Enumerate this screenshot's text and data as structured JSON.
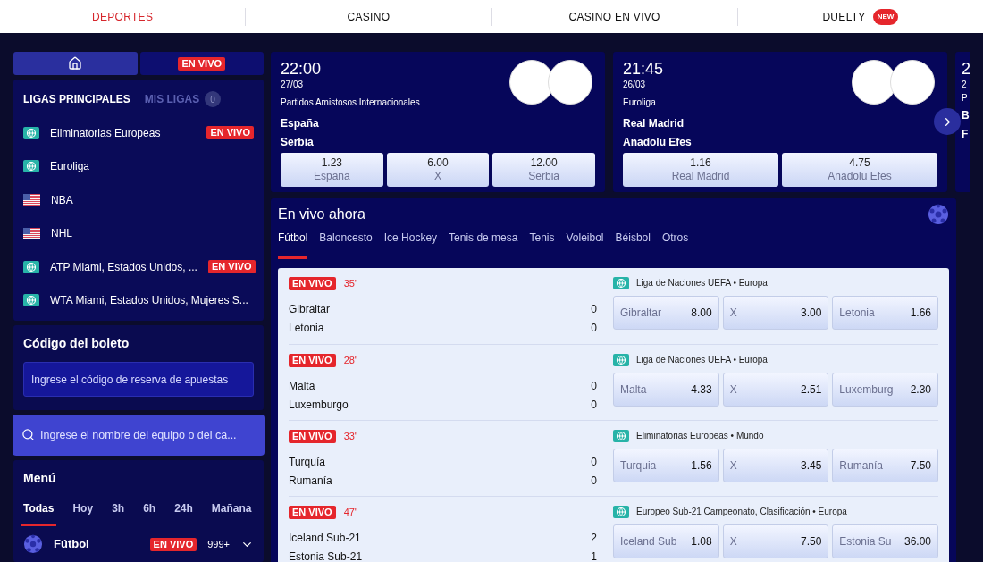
{
  "top_nav": [
    {
      "label": "DEPORTES",
      "selected": true
    },
    {
      "label": "CASINO",
      "selected": false
    },
    {
      "label": "CASINO EN VIVO",
      "selected": false
    },
    {
      "label": "DUELTY",
      "selected": false,
      "badge": "NEW"
    }
  ],
  "sidebar": {
    "view_tabs": [
      {
        "kind": "home",
        "selected": true
      },
      {
        "kind": "live",
        "label": "EN VIVO",
        "selected": false
      }
    ],
    "league_tabs": [
      {
        "label": "LIGAS PRINCIPALES",
        "selected": true
      },
      {
        "label": "MIS LIGAS",
        "selected": false,
        "count": "0"
      }
    ],
    "leagues": [
      {
        "name": "Eliminatorias Europeas",
        "kind": "globe",
        "badge": "EN VIVO"
      },
      {
        "name": "Euroliga",
        "kind": "globe"
      },
      {
        "name": "NBA",
        "kind": "us"
      },
      {
        "name": "NHL",
        "kind": "us"
      },
      {
        "name": "ATP Miami, Estados Unidos, ...",
        "kind": "globe",
        "badge": "EN VIVO"
      },
      {
        "name": "WTA Miami, Estados Unidos, Mujeres S...",
        "kind": "globe"
      }
    ],
    "ticket_code": {
      "title": "Código del boleto",
      "placeholder": "Ingrese el código de reserva de apuestas"
    },
    "search": {
      "placeholder": "Ingrese el nombre del equipo o del ca..."
    },
    "menu": {
      "title": "Menú",
      "filters": [
        {
          "label": "Todas",
          "selected": true
        },
        {
          "label": "Hoy",
          "selected": false
        },
        {
          "label": "3h",
          "selected": false
        },
        {
          "label": "6h",
          "selected": false
        },
        {
          "label": "24h",
          "selected": false
        },
        {
          "label": "Mañana",
          "selected": false
        }
      ],
      "sports": [
        {
          "name": "Fútbol",
          "badge": "EN VIVO",
          "count": "999+",
          "expanded": false
        }
      ]
    }
  },
  "featured": [
    {
      "time": "22:00",
      "date": "27/03",
      "league": "Partidos Amistosos Internacionales",
      "home": "España",
      "away": "Serbia",
      "odds": [
        {
          "value": "1.23",
          "label": "España"
        },
        {
          "value": "6.00",
          "label": "X"
        },
        {
          "value": "12.00",
          "label": "Serbia"
        }
      ]
    },
    {
      "time": "21:45",
      "date": "26/03",
      "league": "Euroliga",
      "home": "Real Madrid",
      "away": "Anadolu Efes",
      "odds": [
        {
          "value": "1.16",
          "label": "Real Madrid"
        },
        {
          "value": "4.75",
          "label": "Anadolu Efes"
        }
      ]
    }
  ],
  "featured_partial": {
    "time": "2",
    "date": "2",
    "league": "P",
    "home": "B",
    "away": "F"
  },
  "live_now": {
    "title": "En vivo ahora",
    "sport_tabs": [
      {
        "label": "Fútbol",
        "selected": true
      },
      {
        "label": "Baloncesto",
        "selected": false
      },
      {
        "label": "Ice Hockey",
        "selected": false
      },
      {
        "label": "Tenis de mesa",
        "selected": false
      },
      {
        "label": "Tenis",
        "selected": false
      },
      {
        "label": "Voleibol",
        "selected": false
      },
      {
        "label": "Béisbol",
        "selected": false
      },
      {
        "label": "Otros",
        "selected": false
      }
    ],
    "matches": [
      {
        "badge": "EN VIVO",
        "minute": "35'",
        "home": "Gibraltar",
        "away": "Letonia",
        "home_score": "0",
        "away_score": "0",
        "league": "Liga de Naciones UEFA • Europa",
        "odds": [
          {
            "label": "Gibraltar",
            "value": "8.00"
          },
          {
            "label": "X",
            "value": "3.00"
          },
          {
            "label": "Letonia",
            "value": "1.66"
          }
        ]
      },
      {
        "badge": "EN VIVO",
        "minute": "28'",
        "home": "Malta",
        "away": "Luxemburgo",
        "home_score": "0",
        "away_score": "0",
        "league": "Liga de Naciones UEFA • Europa",
        "odds": [
          {
            "label": "Malta",
            "value": "4.33"
          },
          {
            "label": "X",
            "value": "2.51"
          },
          {
            "label": "Luxemburg",
            "value": "2.30"
          }
        ]
      },
      {
        "badge": "EN VIVO",
        "minute": "33'",
        "home": "Turquía",
        "away": "Rumanía",
        "home_score": "0",
        "away_score": "0",
        "league": "Eliminatorias Europeas • Mundo",
        "odds": [
          {
            "label": "Turquia",
            "value": "1.56"
          },
          {
            "label": "X",
            "value": "3.45"
          },
          {
            "label": "Rumanía",
            "value": "7.50"
          }
        ]
      },
      {
        "badge": "EN VIVO",
        "minute": "47'",
        "home": "Iceland Sub-21",
        "away": "Estonia Sub-21",
        "home_score": "2",
        "away_score": "1",
        "league": "Europeo Sub-21 Campeonato, Clasificación • Europa",
        "odds": [
          {
            "label": "Iceland Sub",
            "value": "1.08"
          },
          {
            "label": "X",
            "value": "7.50"
          },
          {
            "label": "Estonia Su",
            "value": "36.00"
          }
        ]
      }
    ]
  }
}
